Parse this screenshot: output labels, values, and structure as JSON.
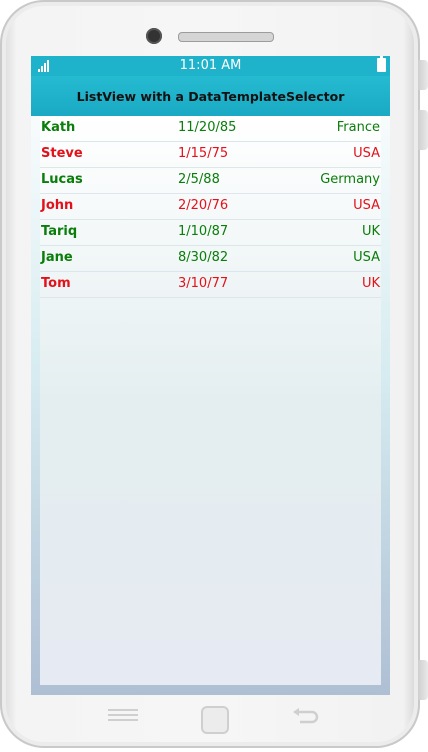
{
  "status_bar": {
    "time": "11:01 AM"
  },
  "page_title": "ListView with a DataTemplateSelector",
  "colors": {
    "accent": "#1fb3cb",
    "green": "#0a7d0a",
    "red": "#e3121a"
  },
  "people": [
    {
      "name": "Kath",
      "dob": "11/20/85",
      "country": "France",
      "color": "green"
    },
    {
      "name": "Steve",
      "dob": "1/15/75",
      "country": "USA",
      "color": "red"
    },
    {
      "name": "Lucas",
      "dob": "2/5/88",
      "country": "Germany",
      "color": "green"
    },
    {
      "name": "John",
      "dob": "2/20/76",
      "country": "USA",
      "color": "red"
    },
    {
      "name": "Tariq",
      "dob": "1/10/87",
      "country": "UK",
      "color": "green"
    },
    {
      "name": "Jane",
      "dob": "8/30/82",
      "country": "USA",
      "color": "green"
    },
    {
      "name": "Tom",
      "dob": "3/10/77",
      "country": "UK",
      "color": "red"
    }
  ],
  "hardware_buttons": [
    "menu-icon",
    "home-icon",
    "back-icon"
  ]
}
